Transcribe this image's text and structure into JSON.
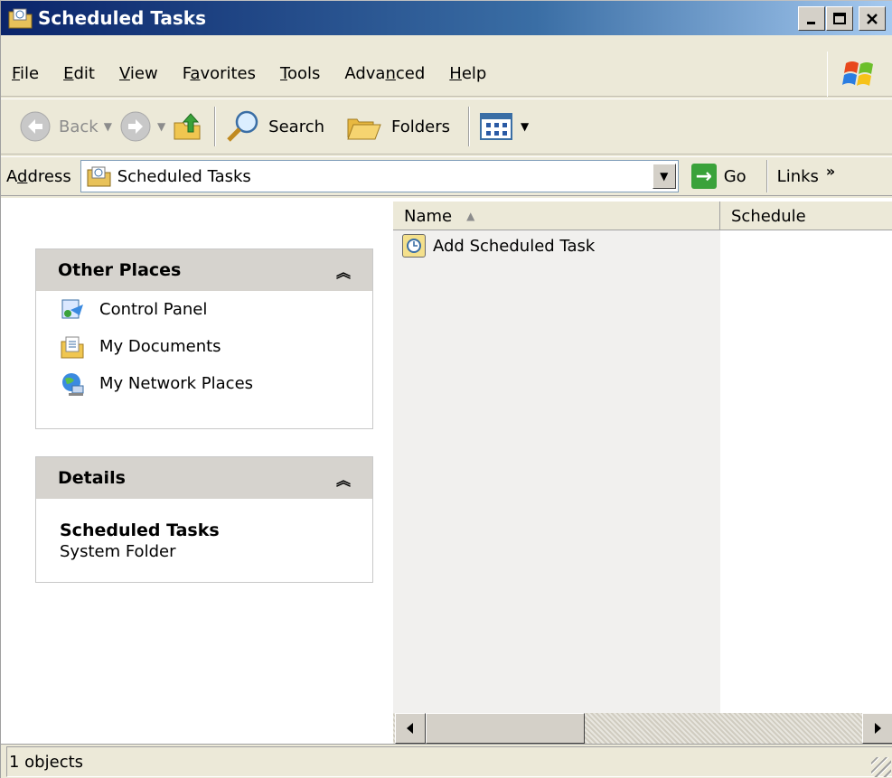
{
  "window": {
    "title": "Scheduled Tasks",
    "icons": {
      "title": "scheduled-tasks-folder-icon",
      "minimize": "minimize-icon",
      "maximize": "maximize-icon",
      "close": "close-icon"
    }
  },
  "menubar": {
    "items": [
      {
        "key": "F",
        "rest": "ile"
      },
      {
        "key": "E",
        "rest": "dit"
      },
      {
        "key": "V",
        "rest": "iew"
      },
      {
        "pre": "F",
        "key": "a",
        "rest": "vorites"
      },
      {
        "key": "T",
        "rest": "ools"
      },
      {
        "pre": "Adva",
        "key": "n",
        "rest": "ced"
      },
      {
        "key": "H",
        "rest": "elp"
      }
    ]
  },
  "toolbar": {
    "back_label": "Back",
    "search_label": "Search",
    "folders_label": "Folders",
    "icons": [
      "back-arrow-icon",
      "forward-arrow-icon",
      "up-folder-icon",
      "search-magnifier-icon",
      "folders-icon",
      "views-icon"
    ]
  },
  "address": {
    "label_pre": "A",
    "label_key": "d",
    "label_rest": "dress",
    "value": "Scheduled Tasks",
    "go_label": "Go",
    "links_label": "Links"
  },
  "left": {
    "other_places": {
      "title": "Other Places",
      "items": [
        {
          "label": "Control Panel",
          "icon": "control-panel-icon"
        },
        {
          "label": "My Documents",
          "icon": "my-documents-icon"
        },
        {
          "label": "My Network Places",
          "icon": "network-places-icon"
        }
      ]
    },
    "details": {
      "title": "Details",
      "name": "Scheduled Tasks",
      "type": "System Folder"
    }
  },
  "list": {
    "columns": [
      "Name",
      "Schedule"
    ],
    "items": [
      {
        "name": "Add Scheduled Task",
        "icon": "add-task-icon"
      }
    ]
  },
  "status": {
    "text": "1 objects"
  },
  "colors": {
    "title_gradient_start": "#0a246a",
    "title_gradient_end": "#a6caf0",
    "chrome": "#ece9d8"
  }
}
